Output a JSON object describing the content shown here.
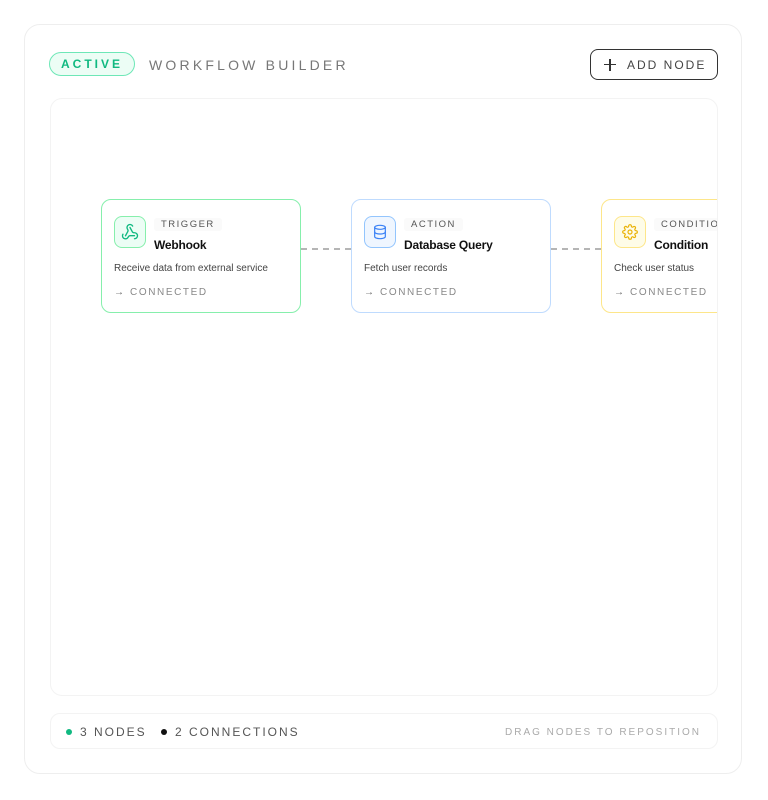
{
  "header": {
    "status_badge": "ACTIVE",
    "title": "WORKFLOW BUILDER",
    "add_node_label": "ADD NODE"
  },
  "nodes": [
    {
      "type": "TRIGGER",
      "name": "Webhook",
      "description": "Receive data from external service",
      "status": "CONNECTED",
      "icon": "webhook-icon",
      "accent": "#34d399"
    },
    {
      "type": "ACTION",
      "name": "Database Query",
      "description": "Fetch user records",
      "status": "CONNECTED",
      "icon": "database-icon",
      "accent": "#60a5fa"
    },
    {
      "type": "CONDITION",
      "name": "Condition",
      "description": "Check user status",
      "status": "CONNECTED",
      "icon": "gear-icon",
      "accent": "#facc15"
    }
  ],
  "footer": {
    "nodes_count": "3 NODES",
    "connections_count": "2 CONNECTIONS",
    "hint": "DRAG NODES TO REPOSITION"
  },
  "colors": {
    "accent_green": "#10b981",
    "accent_blue": "#60a5fa",
    "accent_yellow": "#eab308",
    "border_dark": "#333333"
  }
}
